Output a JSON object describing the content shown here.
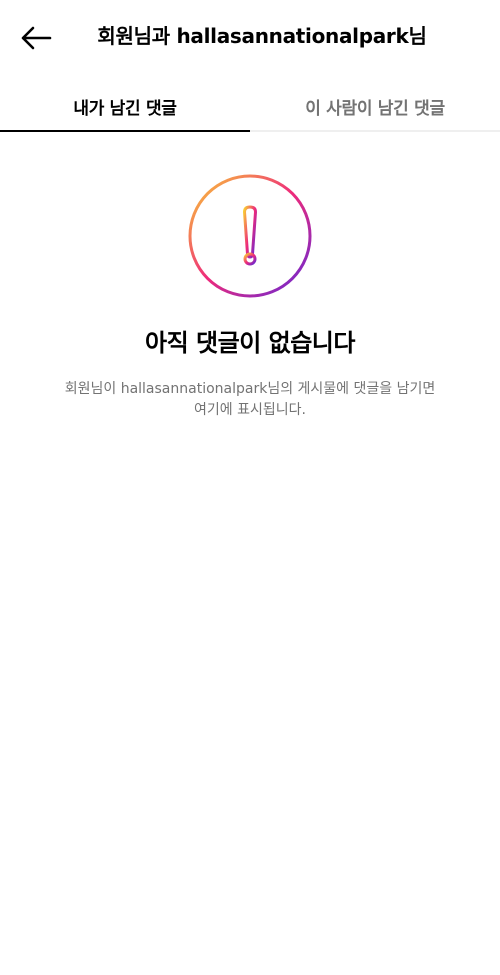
{
  "header": {
    "back_icon": "arrow-left-icon",
    "title": "회원님과 hallasannationalpark님"
  },
  "tabs": [
    {
      "label": "내가 남긴 댓글",
      "active": true
    },
    {
      "label": "이 사람이 남긴 댓글",
      "active": false
    }
  ],
  "empty_state": {
    "icon": "exclamation-circle-icon",
    "title": "아직 댓글이 없습니다",
    "description_line1": "회원님이 hallasannationalpark님의 게시물에 댓글을 남기면",
    "description_line2": "여기에 표시됩니다."
  },
  "colors": {
    "text": "#000000",
    "secondary_text": "#737373",
    "gradient": [
      "#f9ce34",
      "#ee2a7b",
      "#6228d7"
    ]
  }
}
